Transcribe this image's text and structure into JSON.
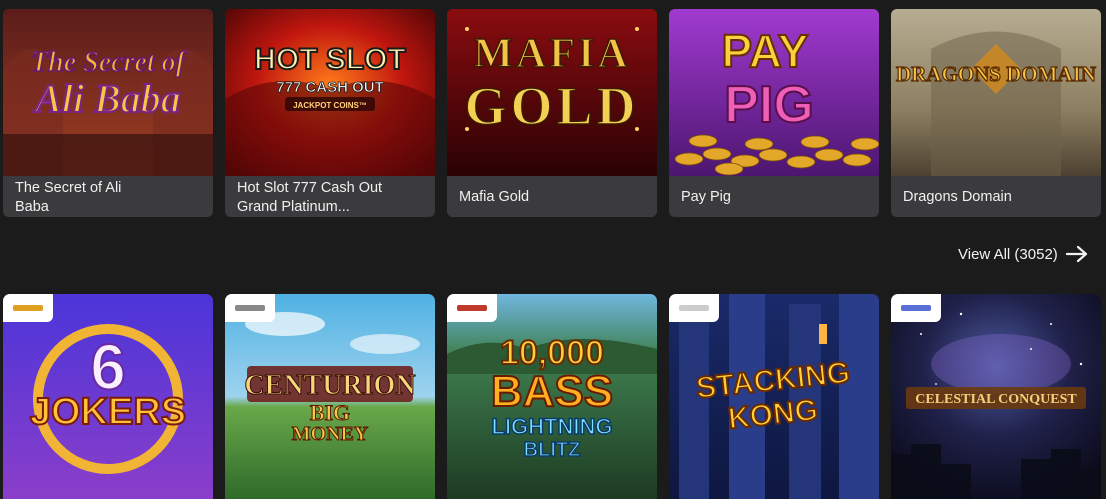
{
  "top_row": [
    {
      "title": "The Secret of Ali Baba",
      "art_text": [
        "The Secret of",
        "Ali Baba"
      ]
    },
    {
      "title": "Hot Slot 777 Cash Out Grand Platinum...",
      "art_text": [
        "HOT SLOT",
        "777 CASH OUT",
        "JACKPOT COINS™"
      ]
    },
    {
      "title": "Mafia Gold",
      "art_text": [
        "MAFIA",
        "GOLD"
      ]
    },
    {
      "title": "Pay Pig",
      "art_text": [
        "PAY",
        "PIG"
      ]
    },
    {
      "title": "Dragons Domain",
      "art_text": [
        "DRAGONS DOMAIN"
      ]
    }
  ],
  "view_all": {
    "label": "View All (3052)",
    "icon": "arrow-right-icon"
  },
  "bottom_row": [
    {
      "art_text": [
        "6",
        "JOKERS"
      ],
      "provider_color": "#e0a020"
    },
    {
      "art_text": [
        "CENTURION",
        "BIG",
        "MONEY"
      ],
      "provider_color": "#888888"
    },
    {
      "art_text": [
        "10,000",
        "BASS",
        "LIGHTNING",
        "BLITZ"
      ],
      "provider_color": "#c0392b"
    },
    {
      "art_text": [
        "STACKING",
        "KONG"
      ],
      "provider_color": "#cccccc"
    },
    {
      "art_text": [
        "CELESTIAL CONQUEST"
      ],
      "provider_color": "#5a6fd6"
    }
  ],
  "colors": {
    "page_bg": "#1b1b1c",
    "caption_bg": "#3b3b3d",
    "text": "#f0f0f0"
  }
}
